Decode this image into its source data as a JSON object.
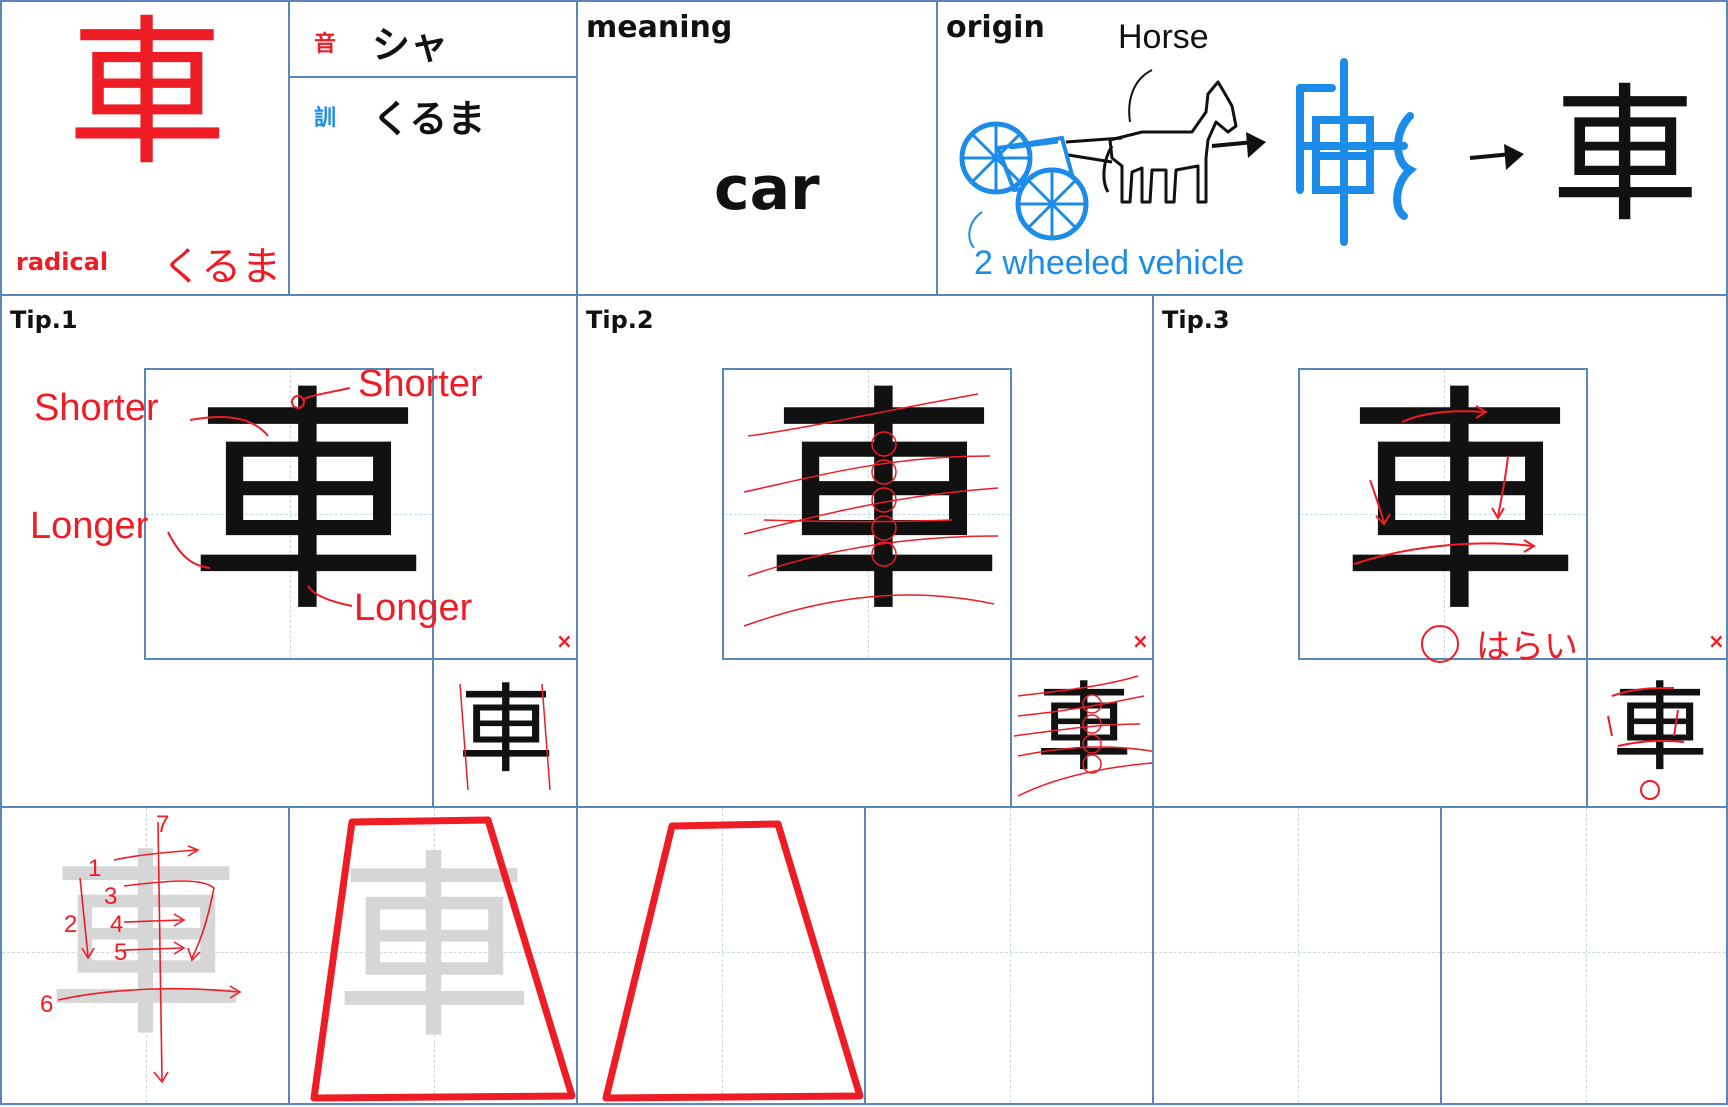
{
  "kanji": "車",
  "radical": {
    "label": "radical",
    "name": "くるま"
  },
  "readings": {
    "on_marker": "音",
    "on_value": "シャ",
    "kun_marker": "訓",
    "kun_value": "くるま"
  },
  "meaning": {
    "label": "meaning",
    "value": "car"
  },
  "origin": {
    "label": "origin",
    "horse_label": "Horse",
    "vehicle_label": "2 wheeled vehicle",
    "ancient_glyph": "車"
  },
  "tips": [
    {
      "label": "Tip.1",
      "annotations": [
        "Shorter",
        "Shorter",
        "Longer",
        "Longer"
      ],
      "mark": "×"
    },
    {
      "label": "Tip.2",
      "mark": "×"
    },
    {
      "label": "Tip.3",
      "harai_label": "はらい",
      "mark": "×"
    }
  ],
  "stroke_order": [
    "1",
    "2",
    "3",
    "4",
    "5",
    "6",
    "7"
  ],
  "colors": {
    "accent": "#ee1c25",
    "origin_blue": "#1d8ce8",
    "grid": "#5b87b8"
  }
}
